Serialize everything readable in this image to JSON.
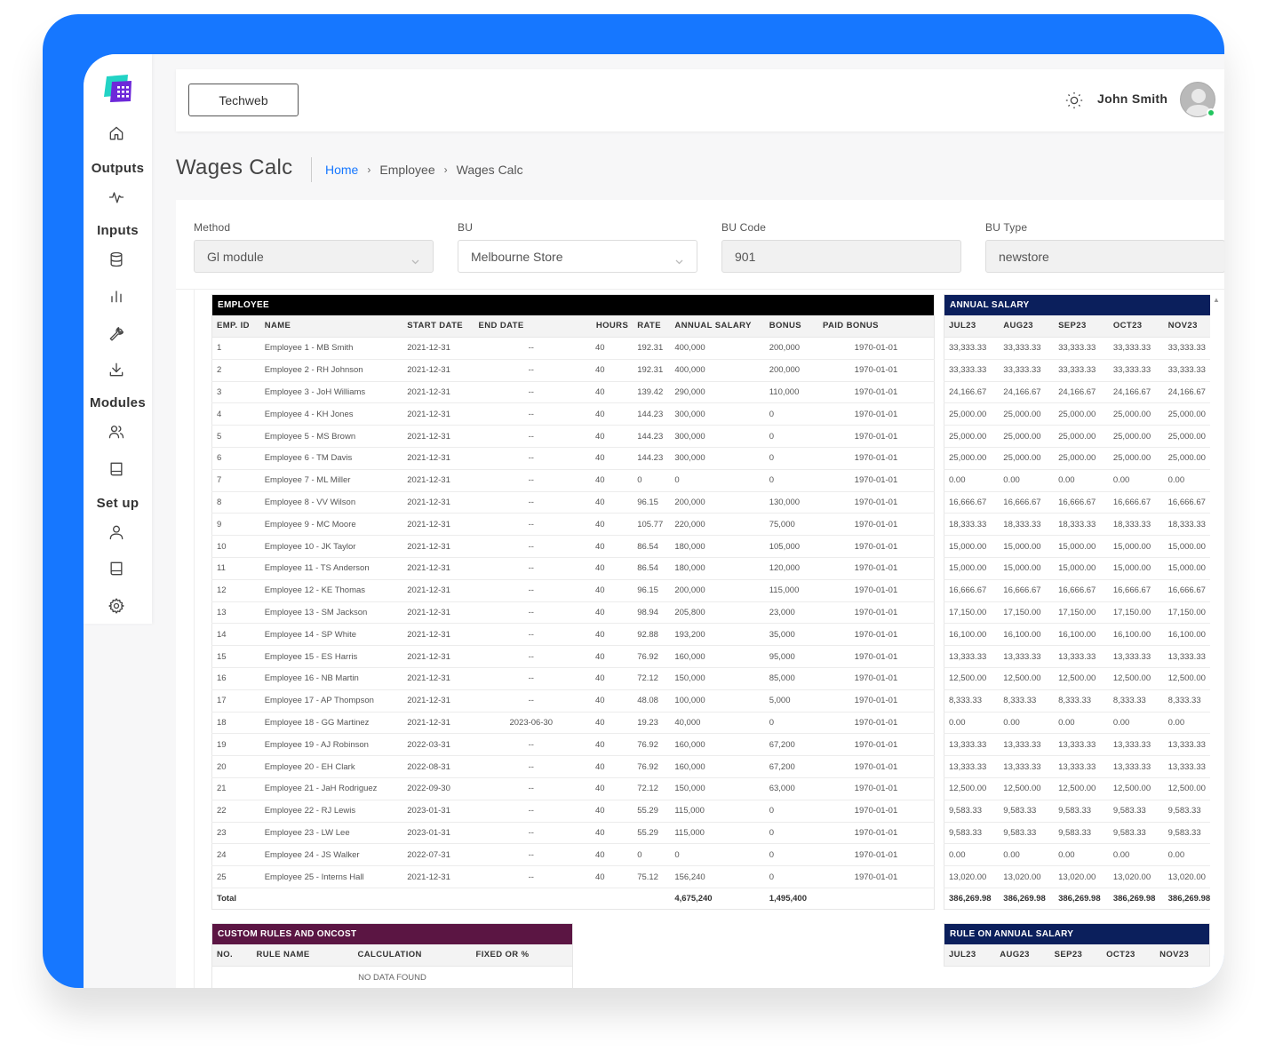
{
  "header": {
    "company_button": "Techweb",
    "user_name": "John Smith"
  },
  "sidebar": {
    "groups": [
      "Outputs",
      "Inputs",
      "Modules",
      "Set up"
    ]
  },
  "page": {
    "title": "Wages Calc",
    "breadcrumb": [
      "Home",
      "Employee",
      "Wages Calc"
    ]
  },
  "form": {
    "method_label": "Method",
    "method_value": "Gl module",
    "bu_label": "BU",
    "bu_value": "Melbourne Store",
    "bu_code_label": "BU Code",
    "bu_code_value": "901",
    "bu_type_label": "BU Type",
    "bu_type_value": "newstore"
  },
  "employee_table": {
    "caption": "EMPLOYEE",
    "columns": [
      "EMP. ID",
      "NAME",
      "START DATE",
      "END DATE",
      "HOURS",
      "RATE",
      "ANNUAL SALARY",
      "BONUS",
      "PAID BONUS"
    ],
    "rows": [
      [
        "1",
        "Employee 1 - MB Smith",
        "2021-12-31",
        "--",
        "40",
        "192.31",
        "400,000",
        "200,000",
        "1970-01-01"
      ],
      [
        "2",
        "Employee 2 - RH Johnson",
        "2021-12-31",
        "--",
        "40",
        "192.31",
        "400,000",
        "200,000",
        "1970-01-01"
      ],
      [
        "3",
        "Employee 3 - JoH Williams",
        "2021-12-31",
        "--",
        "40",
        "139.42",
        "290,000",
        "110,000",
        "1970-01-01"
      ],
      [
        "4",
        "Employee 4 - KH Jones",
        "2021-12-31",
        "--",
        "40",
        "144.23",
        "300,000",
        "0",
        "1970-01-01"
      ],
      [
        "5",
        "Employee 5 - MS Brown",
        "2021-12-31",
        "--",
        "40",
        "144.23",
        "300,000",
        "0",
        "1970-01-01"
      ],
      [
        "6",
        "Employee 6 - TM Davis",
        "2021-12-31",
        "--",
        "40",
        "144.23",
        "300,000",
        "0",
        "1970-01-01"
      ],
      [
        "7",
        "Employee 7 - ML Miller",
        "2021-12-31",
        "--",
        "40",
        "0",
        "0",
        "0",
        "1970-01-01"
      ],
      [
        "8",
        "Employee 8 - VV Wilson",
        "2021-12-31",
        "--",
        "40",
        "96.15",
        "200,000",
        "130,000",
        "1970-01-01"
      ],
      [
        "9",
        "Employee 9 - MC Moore",
        "2021-12-31",
        "--",
        "40",
        "105.77",
        "220,000",
        "75,000",
        "1970-01-01"
      ],
      [
        "10",
        "Employee 10 - JK Taylor",
        "2021-12-31",
        "--",
        "40",
        "86.54",
        "180,000",
        "105,000",
        "1970-01-01"
      ],
      [
        "11",
        "Employee 11 - TS Anderson",
        "2021-12-31",
        "--",
        "40",
        "86.54",
        "180,000",
        "120,000",
        "1970-01-01"
      ],
      [
        "12",
        "Employee 12 - KE Thomas",
        "2021-12-31",
        "--",
        "40",
        "96.15",
        "200,000",
        "115,000",
        "1970-01-01"
      ],
      [
        "13",
        "Employee 13 - SM Jackson",
        "2021-12-31",
        "--",
        "40",
        "98.94",
        "205,800",
        "23,000",
        "1970-01-01"
      ],
      [
        "14",
        "Employee 14 - SP White",
        "2021-12-31",
        "--",
        "40",
        "92.88",
        "193,200",
        "35,000",
        "1970-01-01"
      ],
      [
        "15",
        "Employee 15 - ES Harris",
        "2021-12-31",
        "--",
        "40",
        "76.92",
        "160,000",
        "95,000",
        "1970-01-01"
      ],
      [
        "16",
        "Employee 16 - NB Martin",
        "2021-12-31",
        "--",
        "40",
        "72.12",
        "150,000",
        "85,000",
        "1970-01-01"
      ],
      [
        "17",
        "Employee 17 - AP Thompson",
        "2021-12-31",
        "--",
        "40",
        "48.08",
        "100,000",
        "5,000",
        "1970-01-01"
      ],
      [
        "18",
        "Employee 18 - GG Martinez",
        "2021-12-31",
        "2023-06-30",
        "40",
        "19.23",
        "40,000",
        "0",
        "1970-01-01"
      ],
      [
        "19",
        "Employee 19 - AJ Robinson",
        "2022-03-31",
        "--",
        "40",
        "76.92",
        "160,000",
        "67,200",
        "1970-01-01"
      ],
      [
        "20",
        "Employee 20 - EH Clark",
        "2022-08-31",
        "--",
        "40",
        "76.92",
        "160,000",
        "67,200",
        "1970-01-01"
      ],
      [
        "21",
        "Employee 21 - JaH Rodriguez",
        "2022-09-30",
        "--",
        "40",
        "72.12",
        "150,000",
        "63,000",
        "1970-01-01"
      ],
      [
        "22",
        "Employee 22 - RJ Lewis",
        "2023-01-31",
        "--",
        "40",
        "55.29",
        "115,000",
        "0",
        "1970-01-01"
      ],
      [
        "23",
        "Employee 23 - LW Lee",
        "2023-01-31",
        "--",
        "40",
        "55.29",
        "115,000",
        "0",
        "1970-01-01"
      ],
      [
        "24",
        "Employee 24 - JS Walker",
        "2022-07-31",
        "--",
        "40",
        "0",
        "0",
        "0",
        "1970-01-01"
      ],
      [
        "25",
        "Employee 25 - Interns Hall",
        "2021-12-31",
        "--",
        "40",
        "75.12",
        "156,240",
        "0",
        "1970-01-01"
      ]
    ],
    "total_label": "Total",
    "total_annual_salary": "4,675,240",
    "total_bonus": "1,495,400"
  },
  "salary_table": {
    "caption": "ANNUAL SALARY",
    "columns": [
      "JUL23",
      "AUG23",
      "SEP23",
      "OCT23",
      "NOV23"
    ],
    "rows": [
      [
        "33,333.33",
        "33,333.33",
        "33,333.33",
        "33,333.33",
        "33,333.33"
      ],
      [
        "33,333.33",
        "33,333.33",
        "33,333.33",
        "33,333.33",
        "33,333.33"
      ],
      [
        "24,166.67",
        "24,166.67",
        "24,166.67",
        "24,166.67",
        "24,166.67"
      ],
      [
        "25,000.00",
        "25,000.00",
        "25,000.00",
        "25,000.00",
        "25,000.00"
      ],
      [
        "25,000.00",
        "25,000.00",
        "25,000.00",
        "25,000.00",
        "25,000.00"
      ],
      [
        "25,000.00",
        "25,000.00",
        "25,000.00",
        "25,000.00",
        "25,000.00"
      ],
      [
        "0.00",
        "0.00",
        "0.00",
        "0.00",
        "0.00"
      ],
      [
        "16,666.67",
        "16,666.67",
        "16,666.67",
        "16,666.67",
        "16,666.67"
      ],
      [
        "18,333.33",
        "18,333.33",
        "18,333.33",
        "18,333.33",
        "18,333.33"
      ],
      [
        "15,000.00",
        "15,000.00",
        "15,000.00",
        "15,000.00",
        "15,000.00"
      ],
      [
        "15,000.00",
        "15,000.00",
        "15,000.00",
        "15,000.00",
        "15,000.00"
      ],
      [
        "16,666.67",
        "16,666.67",
        "16,666.67",
        "16,666.67",
        "16,666.67"
      ],
      [
        "17,150.00",
        "17,150.00",
        "17,150.00",
        "17,150.00",
        "17,150.00"
      ],
      [
        "16,100.00",
        "16,100.00",
        "16,100.00",
        "16,100.00",
        "16,100.00"
      ],
      [
        "13,333.33",
        "13,333.33",
        "13,333.33",
        "13,333.33",
        "13,333.33"
      ],
      [
        "12,500.00",
        "12,500.00",
        "12,500.00",
        "12,500.00",
        "12,500.00"
      ],
      [
        "8,333.33",
        "8,333.33",
        "8,333.33",
        "8,333.33",
        "8,333.33"
      ],
      [
        "0.00",
        "0.00",
        "0.00",
        "0.00",
        "0.00"
      ],
      [
        "13,333.33",
        "13,333.33",
        "13,333.33",
        "13,333.33",
        "13,333.33"
      ],
      [
        "13,333.33",
        "13,333.33",
        "13,333.33",
        "13,333.33",
        "13,333.33"
      ],
      [
        "12,500.00",
        "12,500.00",
        "12,500.00",
        "12,500.00",
        "12,500.00"
      ],
      [
        "9,583.33",
        "9,583.33",
        "9,583.33",
        "9,583.33",
        "9,583.33"
      ],
      [
        "9,583.33",
        "9,583.33",
        "9,583.33",
        "9,583.33",
        "9,583.33"
      ],
      [
        "0.00",
        "0.00",
        "0.00",
        "0.00",
        "0.00"
      ],
      [
        "13,020.00",
        "13,020.00",
        "13,020.00",
        "13,020.00",
        "13,020.00"
      ]
    ],
    "totals": [
      "386,269.98",
      "386,269.98",
      "386,269.98",
      "386,269.98",
      "386,269.98"
    ]
  },
  "rules_table": {
    "caption": "CUSTOM RULES AND ONCOST",
    "columns": [
      "NO.",
      "RULE NAME",
      "CALCULATION",
      "FIXED OR %"
    ],
    "empty_text": "NO DATA FOUND"
  },
  "rule_salary_table": {
    "caption": "RULE ON ANNUAL SALARY",
    "columns": [
      "JUL23",
      "AUG23",
      "SEP23",
      "OCT23",
      "NOV23"
    ]
  },
  "colors": {
    "frame": "#1677ff",
    "employee_caption": "#000000",
    "salary_caption": "#0b1f5c",
    "rules_caption": "#5b1543",
    "online": "#22c55e"
  }
}
